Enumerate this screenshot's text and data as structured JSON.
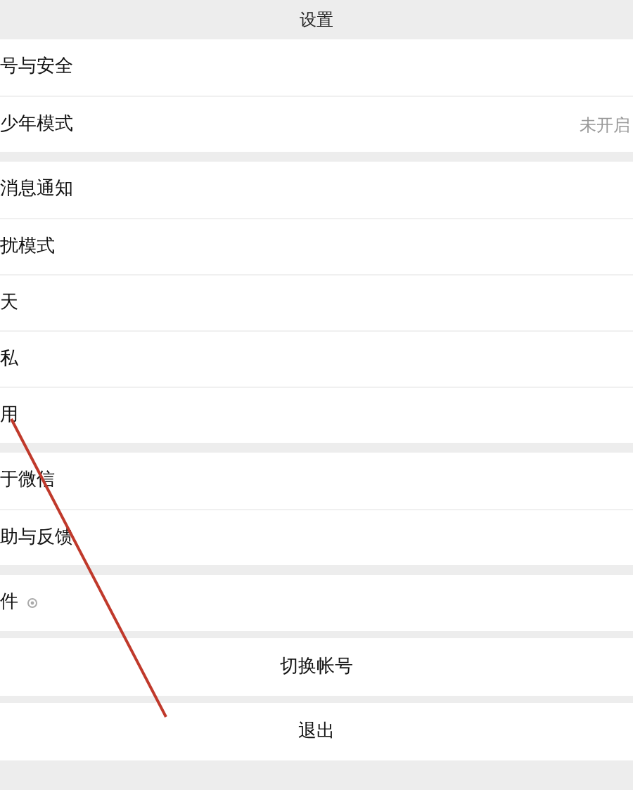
{
  "header": {
    "title": "设置"
  },
  "groups": [
    {
      "rows": [
        {
          "kind": "item",
          "label": "号与安全",
          "icon": false
        },
        {
          "kind": "item",
          "label": "少年模式",
          "value": "未开启",
          "icon": false
        }
      ]
    },
    {
      "rows": [
        {
          "kind": "item",
          "label": "消息通知",
          "icon": false
        },
        {
          "kind": "item",
          "label": "扰模式",
          "icon": false
        },
        {
          "kind": "item",
          "label": "天",
          "icon": false
        },
        {
          "kind": "item",
          "label": "私",
          "icon": false
        },
        {
          "kind": "item",
          "label": "用",
          "icon": false
        }
      ]
    },
    {
      "rows": [
        {
          "kind": "item",
          "label": "于微信",
          "icon": false
        },
        {
          "kind": "item",
          "label": "助与反馈",
          "icon": false
        }
      ]
    },
    {
      "rows": [
        {
          "kind": "item",
          "label": "件",
          "icon": true
        }
      ]
    },
    {
      "rows": [
        {
          "kind": "action",
          "label": "切换帐号"
        }
      ]
    },
    {
      "rows": [
        {
          "kind": "action",
          "label": "退出"
        }
      ]
    }
  ]
}
